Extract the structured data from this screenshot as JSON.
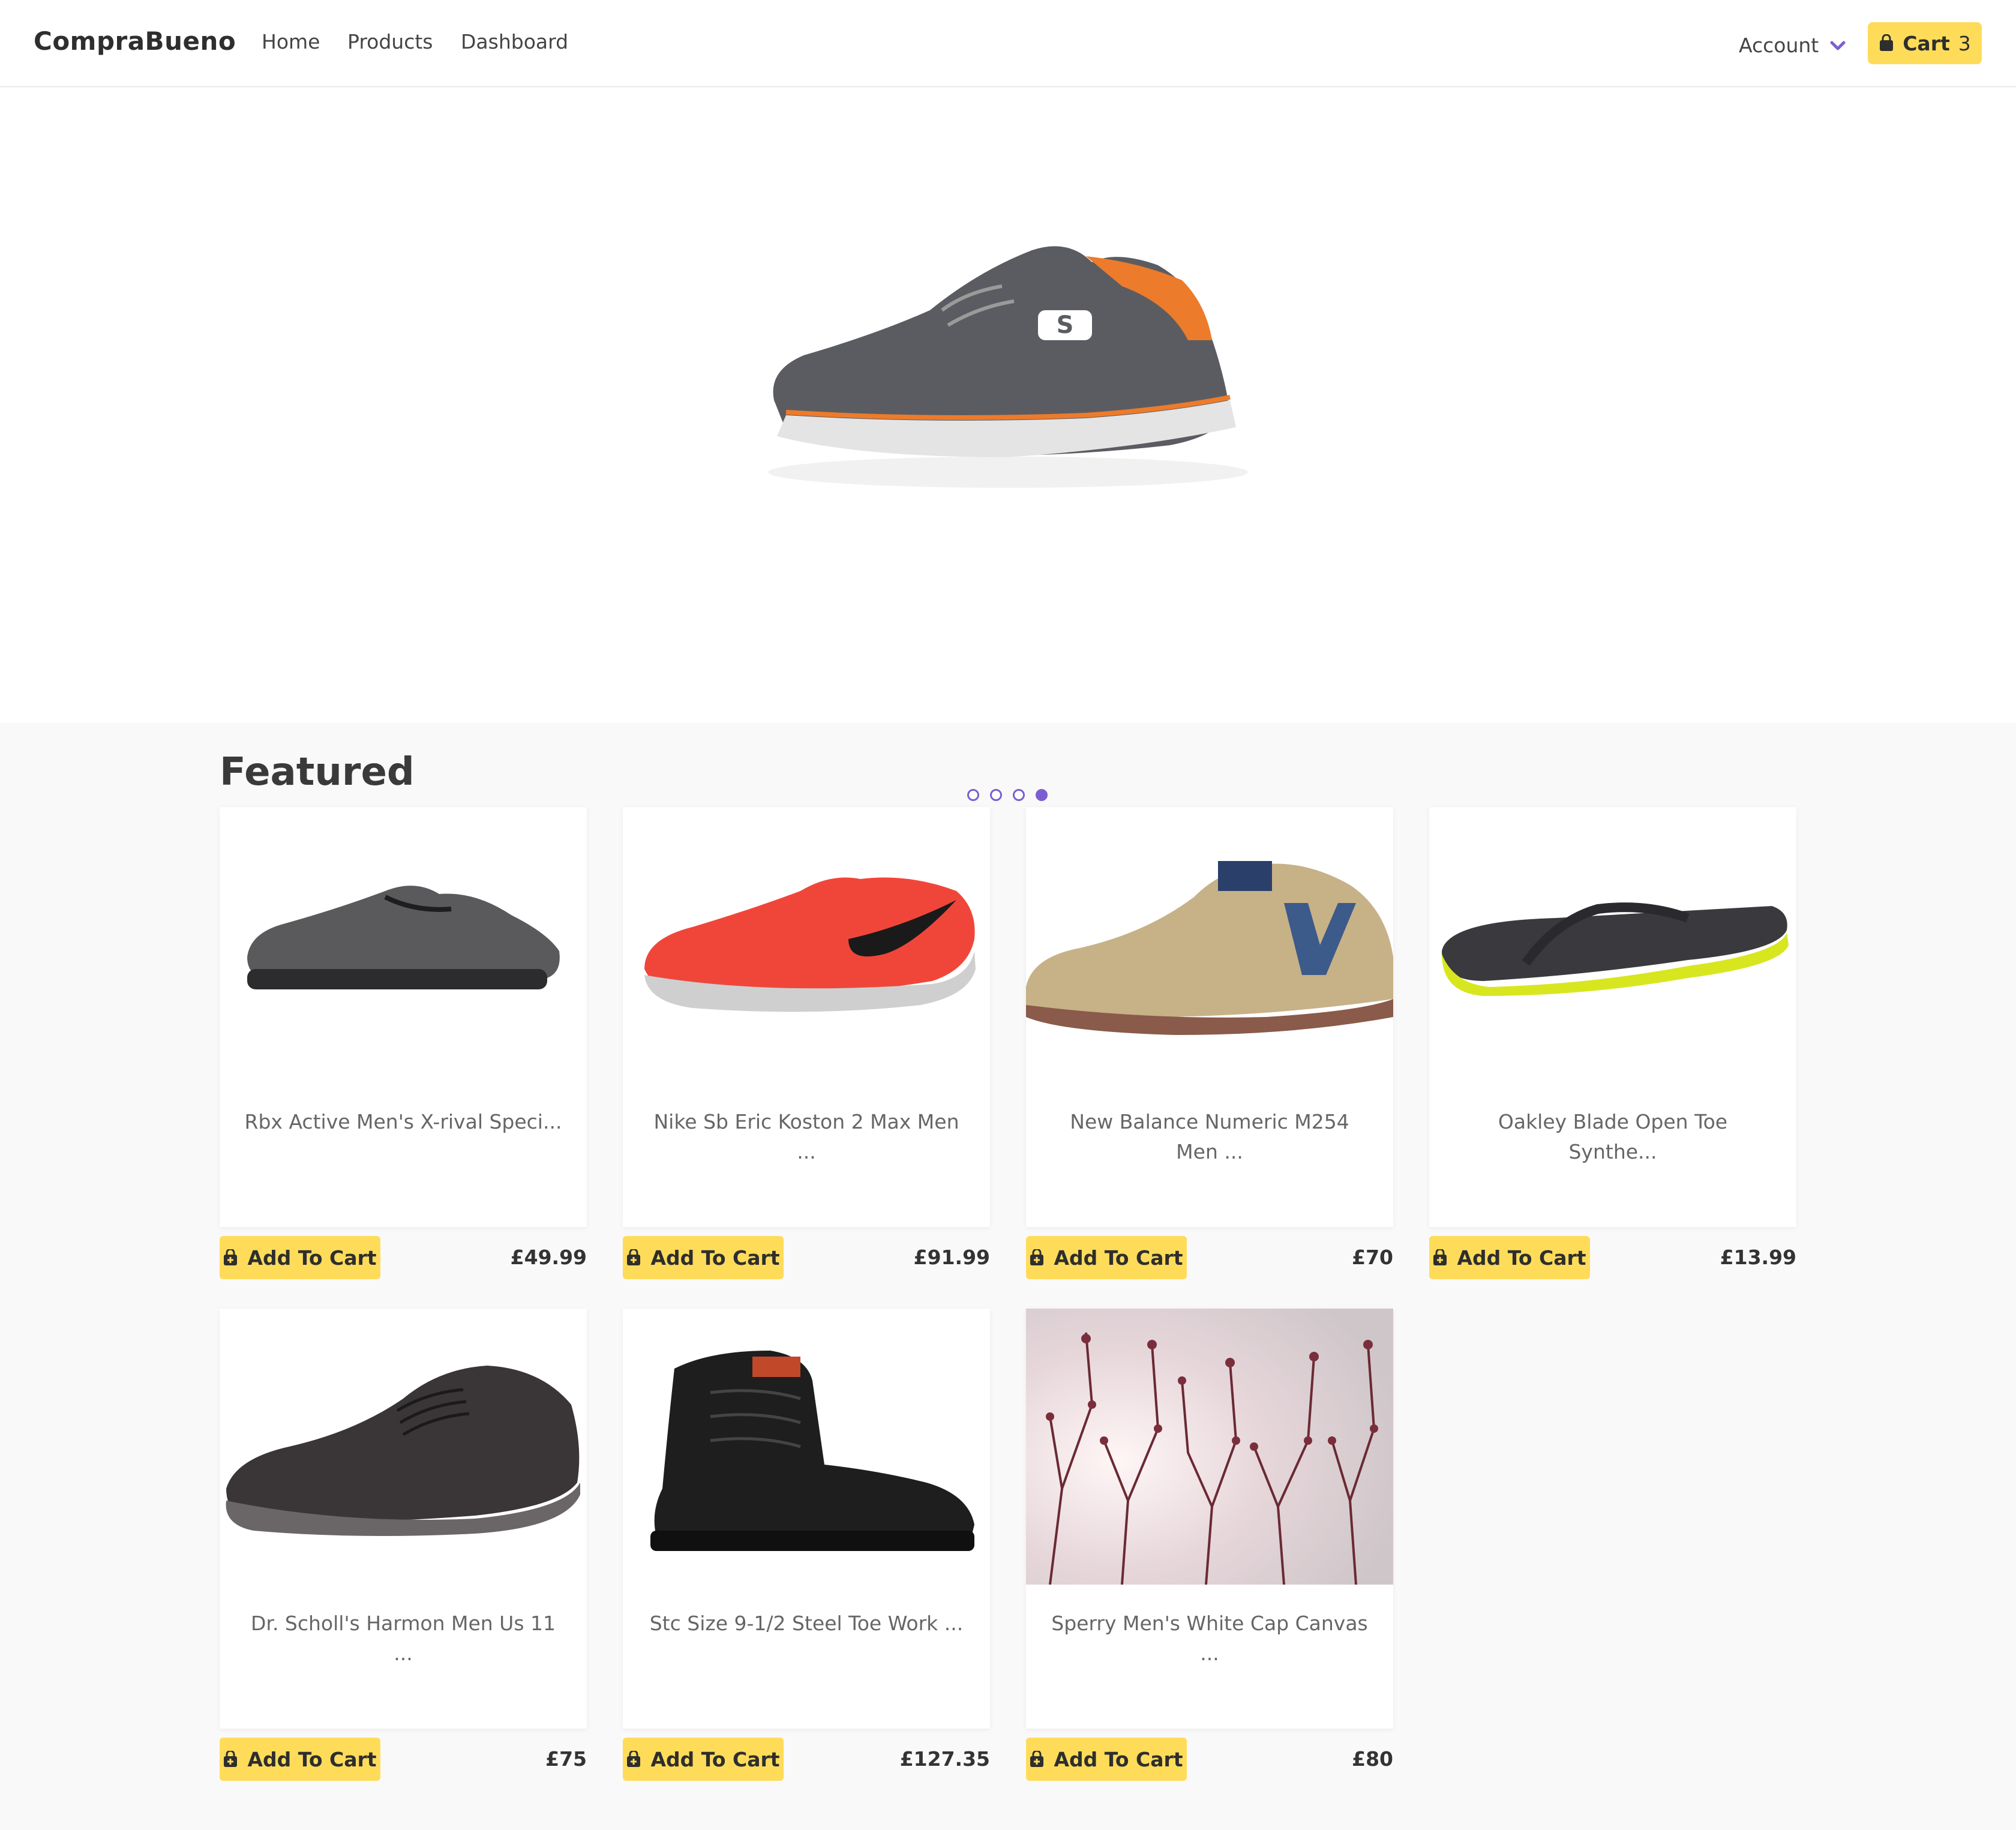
{
  "navbar": {
    "brand": "CompraBueno",
    "links": [
      "Home",
      "Products",
      "Dashboard"
    ],
    "account_label": "Account",
    "cart_label": "Cart",
    "cart_count": "3"
  },
  "carousel": {
    "total_slides": 4,
    "active_slide": 4
  },
  "featured": {
    "title": "Featured",
    "button_label": "Add To Cart",
    "products": [
      {
        "name": "Rbx Active Men's X-rival Speci...",
        "price": "£49.99"
      },
      {
        "name": "Nike Sb Eric Koston 2 Max Men ...",
        "price": "£91.99"
      },
      {
        "name": "New Balance Numeric M254 Men ...",
        "price": "£70"
      },
      {
        "name": "Oakley Blade Open Toe Synthe...",
        "price": "£13.99"
      },
      {
        "name": "Dr. Scholl's Harmon Men Us 11 ...",
        "price": "£75"
      },
      {
        "name": "Stc Size 9-1/2 Steel Toe Work ...",
        "price": "£127.35"
      },
      {
        "name": "Sperry Men's White Cap Canvas ...",
        "price": "£80"
      }
    ]
  },
  "colors": {
    "accent_yellow": "#fedc5a",
    "accent_purple": "#7b5fd1"
  }
}
